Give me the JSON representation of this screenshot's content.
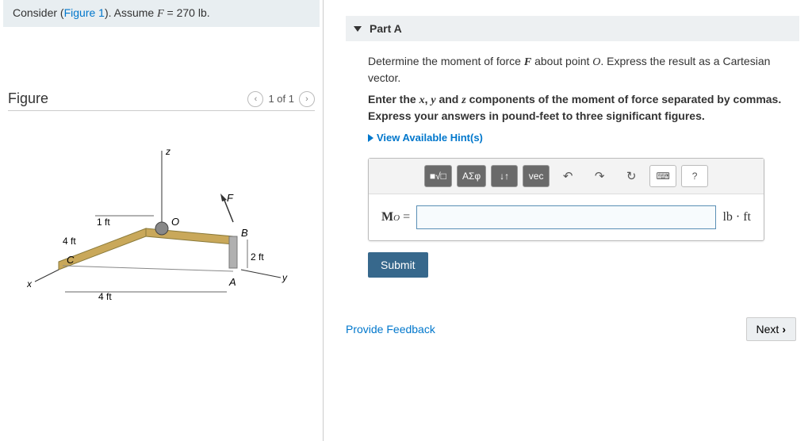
{
  "problem": {
    "prefix": "Consider (",
    "figure_link": "Figure 1",
    "suffix": "). Assume ",
    "var": "F",
    "eq": " = 270 lb."
  },
  "figure": {
    "title": "Figure",
    "nav": "1 of 1",
    "labels": {
      "z": "z",
      "x": "x",
      "y": "y",
      "F": "F",
      "O": "O",
      "A": "A",
      "B": "B",
      "C": "C",
      "d1": "1 ft",
      "d4a": "4 ft",
      "d4b": "4 ft",
      "d2": "2 ft"
    }
  },
  "part": {
    "title": "Part A",
    "instr1_a": "Determine the moment of force ",
    "instr1_F": "F",
    "instr1_b": " about point ",
    "instr1_O": "O",
    "instr1_c": ". Express the result as a Cartesian vector.",
    "instr2_a": "Enter the ",
    "instr2_x": "x",
    "instr2_b": ", ",
    "instr2_y": "y",
    "instr2_c": " and ",
    "instr2_z": "z",
    "instr2_d": " components of the moment of force separated by commas. Express your answers in pound-feet to three significant figures.",
    "hints": "View Available Hint(s)"
  },
  "toolbar": {
    "tmpl": "■√□",
    "greek": "ΑΣφ",
    "subsup": "↓↑",
    "vec": "vec",
    "undo": "↶",
    "redo": "↷",
    "reset": "↻",
    "keyboard": "⌨",
    "help": "?"
  },
  "answer": {
    "label_M": "M",
    "label_O": "O",
    "eq": " =",
    "unit": "lb · ft",
    "value": ""
  },
  "buttons": {
    "submit": "Submit",
    "feedback": "Provide Feedback",
    "next": "Next"
  }
}
